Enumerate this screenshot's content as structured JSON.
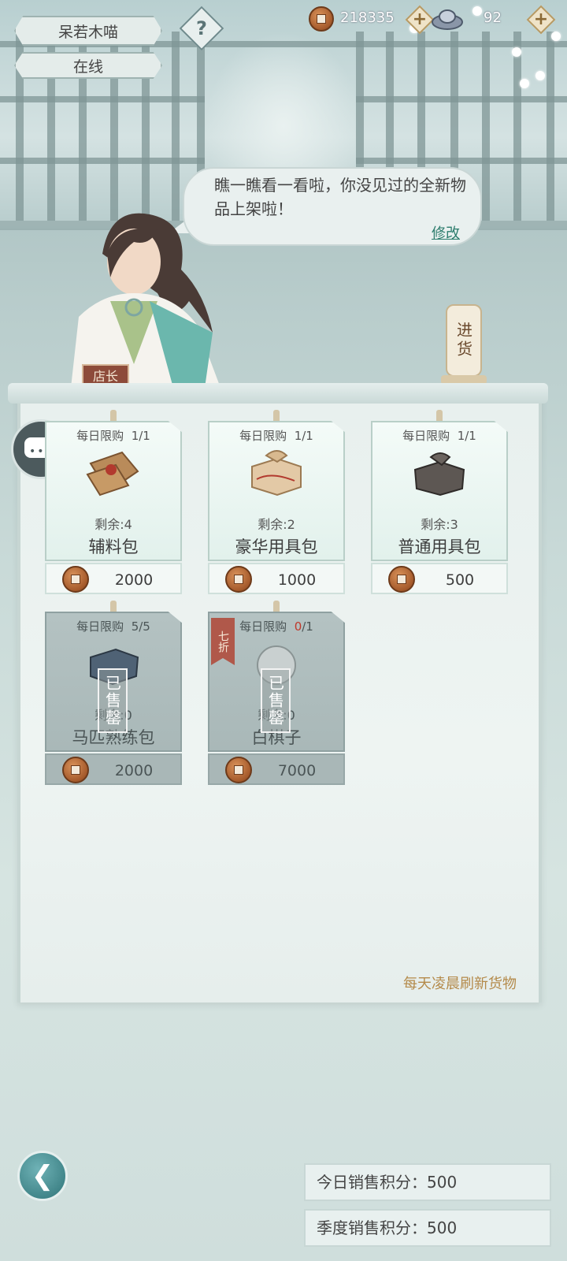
{
  "player": {
    "name": "呆若木喵",
    "status": "在线",
    "help_glyph": "?"
  },
  "currency": {
    "coins": "218335",
    "silver": "92",
    "plus_glyph": "+"
  },
  "shopkeeper": {
    "speech": "瞧一瞧看一看啦，你没见过的全新物品上架啦！",
    "edit_label": "修改",
    "badge": "店长"
  },
  "restock_label": "进货",
  "refresh_note": "每天凌晨刷新货物",
  "items": [
    {
      "limit_label": "每日限购",
      "limit_used": "1",
      "limit_total": "/1",
      "remain": "剩余:4",
      "name": "辅料包",
      "price": "2000",
      "sold": false
    },
    {
      "limit_label": "每日限购",
      "limit_used": "1",
      "limit_total": "/1",
      "remain": "剩余:2",
      "name": "豪华用具包",
      "price": "1000",
      "sold": false
    },
    {
      "limit_label": "每日限购",
      "limit_used": "1",
      "limit_total": "/1",
      "remain": "剩余:3",
      "name": "普通用具包",
      "price": "500",
      "sold": false
    },
    {
      "limit_label": "每日限购",
      "limit_used": "5",
      "limit_total": "/5",
      "remain": "剩余:0",
      "name": "马匹熟练包",
      "price": "2000",
      "sold": true,
      "sold_label": "已售罄"
    },
    {
      "limit_label": "每日限购",
      "limit_used": "0",
      "limit_total": "/1",
      "remain": "剩余:0",
      "name": "白棋子",
      "price": "7000",
      "sold": true,
      "sold_label": "已售罄",
      "discount": "七折"
    }
  ],
  "scores": {
    "today_label": "今日销售积分：",
    "today_value": "500",
    "season_label": "季度销售积分：",
    "season_value": "500"
  },
  "icons": {
    "back": "chevron-left-icon",
    "chat": "chat-icon",
    "coin": "copper-coin-icon",
    "silver": "silver-ingot-icon"
  },
  "colors": {
    "accent": "#2c7c6c",
    "note": "#b48a4a",
    "discount_red": "#b0584a",
    "limit_zero": "#c0392b"
  }
}
